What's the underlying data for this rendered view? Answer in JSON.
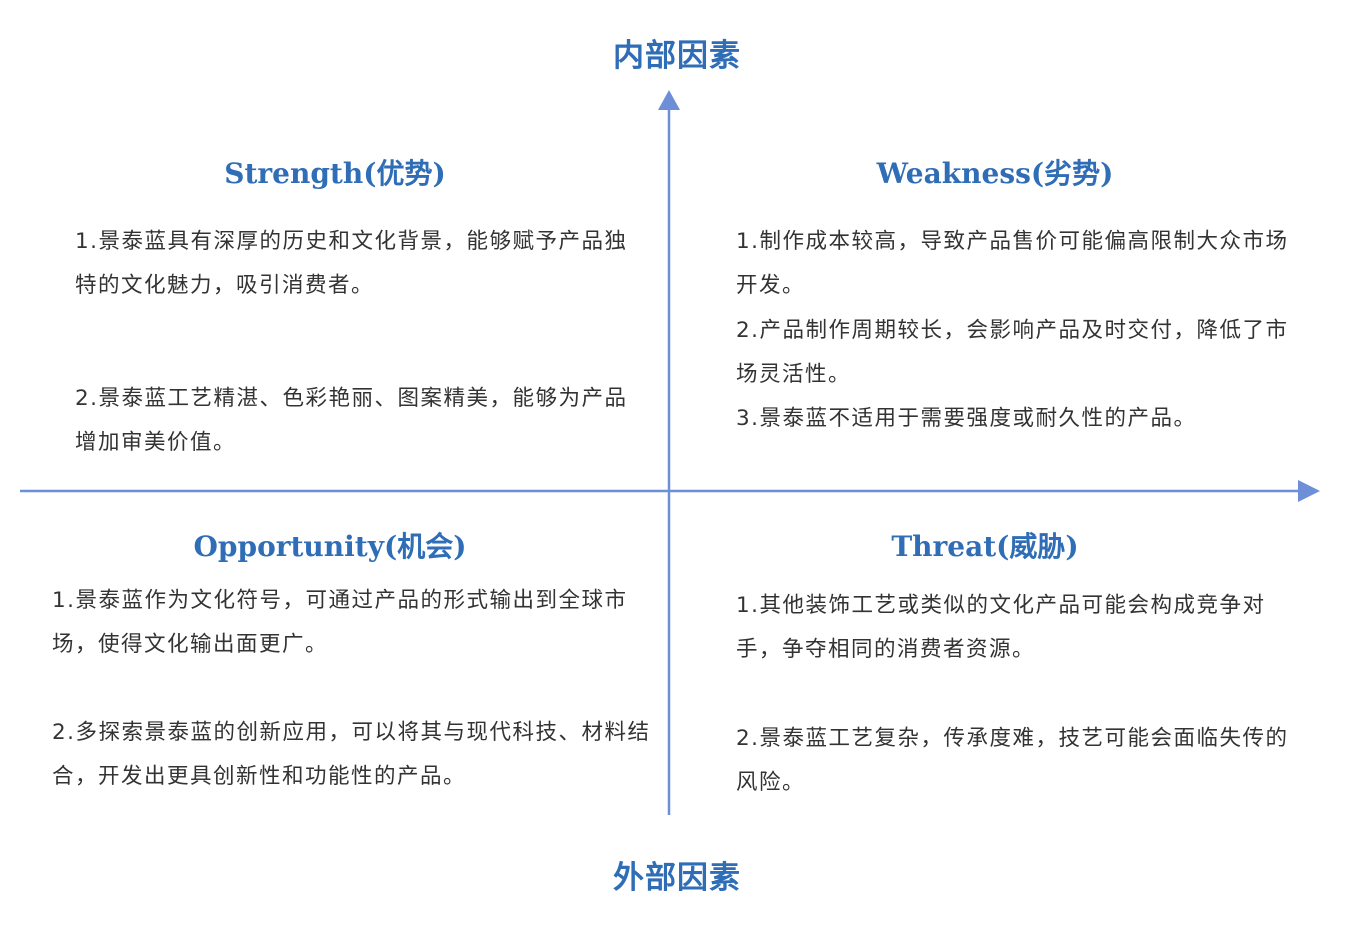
{
  "colors": {
    "accent": "#2f6db6",
    "axis": "#6d8fd8",
    "text": "#333333"
  },
  "axes": {
    "top_label": "内部因素",
    "bottom_label": "外部因素"
  },
  "quadrants": {
    "strength": {
      "title": "Strength(优势)",
      "items": [
        "1.景泰蓝具有深厚的历史和文化背景，能够赋予产品独特的文化魅力，吸引消费者。",
        "2.景泰蓝工艺精湛、色彩艳丽、图案精美，能够为产品增加审美价值。"
      ]
    },
    "weakness": {
      "title": "Weakness(劣势)",
      "items": [
        "1.制作成本较高，导致产品售价可能偏高限制大众市场开发。",
        "2.产品制作周期较长，会影响产品及时交付，降低了市场灵活性。",
        "3.景泰蓝不适用于需要强度或耐久性的产品。"
      ]
    },
    "opportunity": {
      "title": "Opportunity(机会)",
      "items": [
        "1.景泰蓝作为文化符号，可通过产品的形式输出到全球市场，使得文化输出面更广。",
        "2.多探索景泰蓝的创新应用，可以将其与现代科技、材料结合，开发出更具创新性和功能性的产品。"
      ]
    },
    "threat": {
      "title": "Threat(威胁)",
      "items": [
        "1.其他装饰工艺或类似的文化产品可能会构成竞争对手，争夺相同的消费者资源。",
        "2.景泰蓝工艺复杂，传承度难，技艺可能会面临失传的风险。"
      ]
    }
  }
}
